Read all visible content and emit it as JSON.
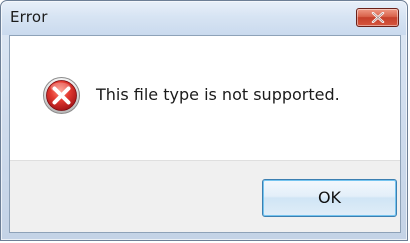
{
  "window": {
    "title": "Error",
    "close_icon": "close-icon"
  },
  "dialog": {
    "icon": "error-icon",
    "message": "This file type is not supported.",
    "ok_label": "OK"
  },
  "colors": {
    "error_red": "#d52b2b",
    "close_red": "#c5402b",
    "button_border": "#3c7fb1"
  }
}
